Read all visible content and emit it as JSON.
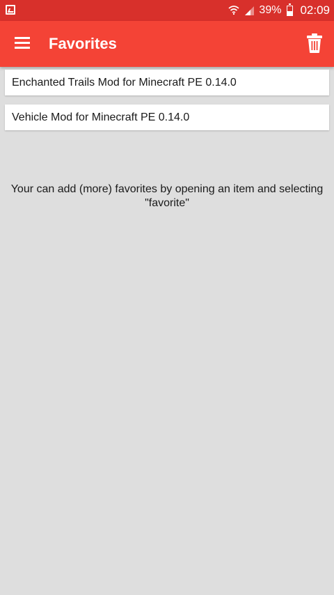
{
  "status_bar": {
    "battery_percent": "39%",
    "time": "02:09",
    "icons": [
      "picture-notification-icon",
      "wifi-icon",
      "signal-icon",
      "battery-icon"
    ]
  },
  "app_bar": {
    "title": "Favorites",
    "menu_icon": "hamburger-menu-icon",
    "action_icon": "trash-icon"
  },
  "favorites": [
    {
      "label": "Enchanted Trails Mod for Minecraft PE 0.14.0"
    },
    {
      "label": "Vehicle Mod for Minecraft PE 0.14.0"
    }
  ],
  "hint": {
    "line1": "Your can add (more) favorites by opening an item and selecting",
    "line2": "\"favorite\""
  },
  "colors": {
    "status_bar": "#d8302b",
    "app_bar": "#f44336",
    "background": "#dedede",
    "card": "#ffffff"
  }
}
